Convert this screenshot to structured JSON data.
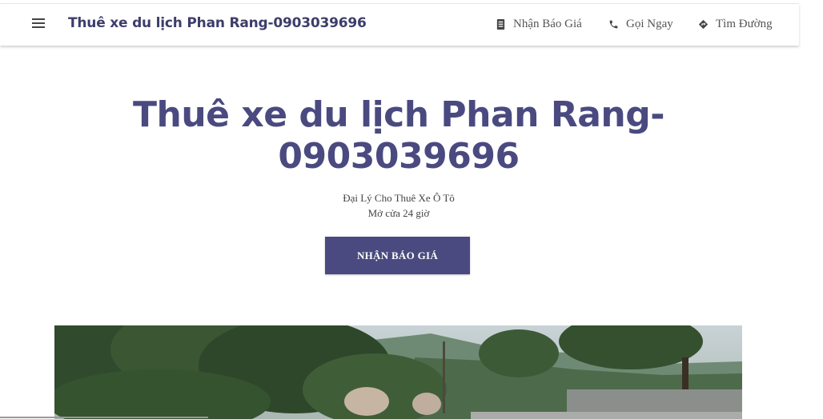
{
  "header": {
    "brand": "Thuê xe du lịch Phan Rang-0903039696",
    "nav": [
      {
        "label": "Nhận Báo Giá",
        "icon": "quote-doc-icon"
      },
      {
        "label": "Gọi Ngay",
        "icon": "phone-icon"
      },
      {
        "label": "Tìm Đường",
        "icon": "directions-icon"
      }
    ]
  },
  "hero": {
    "title_line1": "Thuê xe du lịch Phan Rang-",
    "title_line2": "0903039696",
    "category": "Đại Lý Cho Thuê Xe Ô Tô",
    "hours": "Mở cửa 24 giờ",
    "cta_label": "NHẬN BÁO GIÁ"
  },
  "colors": {
    "accent": "#4a4a80",
    "header_bg": "#ffffff"
  }
}
